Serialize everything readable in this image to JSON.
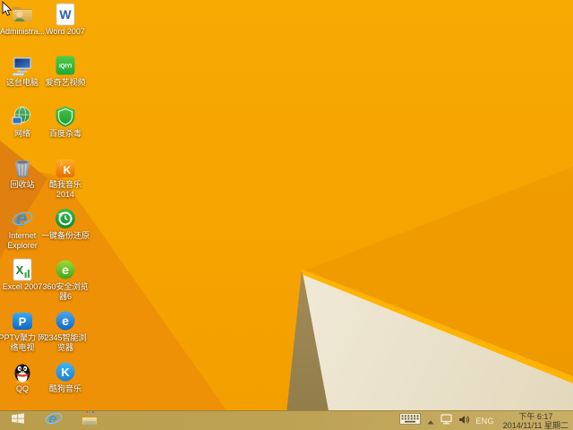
{
  "desktop": {
    "cursor": "arrow-cursor",
    "icons": [
      {
        "id": "administrator",
        "type": "admin-folder",
        "icon": "administrator-folder-icon",
        "label_lines": [
          "Administra..."
        ],
        "col": 0,
        "row": 0
      },
      {
        "id": "word-2007",
        "type": "word",
        "icon": "word-2007-icon",
        "glyph": "W",
        "label_lines": [
          "Word 2007"
        ],
        "col": 1,
        "row": 0
      },
      {
        "id": "this-pc",
        "type": "this-pc",
        "icon": "this-pc-icon",
        "label_lines": [
          "这台电脑"
        ],
        "col": 0,
        "row": 1
      },
      {
        "id": "iqiyi-video",
        "type": "iqiyi",
        "icon": "iqiyi-icon",
        "glyph": "iQIYI",
        "label_lines": [
          "爱奇艺视频"
        ],
        "col": 1,
        "row": 1
      },
      {
        "id": "network",
        "type": "network",
        "icon": "network-globe-icon",
        "label_lines": [
          "网络"
        ],
        "col": 0,
        "row": 2
      },
      {
        "id": "baidu-antivirus",
        "type": "baidu-av",
        "icon": "baidu-antivirus-shield-icon",
        "label_lines": [
          "百度杀毒"
        ],
        "col": 1,
        "row": 2
      },
      {
        "id": "recycle-bin",
        "type": "recycle-bin",
        "icon": "recycle-bin-icon",
        "label_lines": [
          "回收站"
        ],
        "col": 0,
        "row": 3
      },
      {
        "id": "kuwo-music-2014",
        "type": "kuwo",
        "icon": "kuwo-music-icon",
        "glyph": "K",
        "label_lines": [
          "酷我音乐",
          "2014"
        ],
        "col": 1,
        "row": 3
      },
      {
        "id": "internet-explorer",
        "type": "ie",
        "icon": "internet-explorer-icon",
        "glyph": "e",
        "label_lines": [
          "Internet",
          "Explorer"
        ],
        "col": 0,
        "row": 4
      },
      {
        "id": "onekey-backup-restore",
        "type": "backup",
        "icon": "onekey-backup-restore-icon",
        "label_lines": [
          "一键备份还原"
        ],
        "col": 1,
        "row": 4
      },
      {
        "id": "excel-2007",
        "type": "excel",
        "icon": "excel-2007-icon",
        "glyph": "X",
        "label_lines": [
          "Excel 2007"
        ],
        "col": 0,
        "row": 5
      },
      {
        "id": "360-safe-browser-6",
        "type": "b360se",
        "icon": "360-browser-icon",
        "glyph": "e",
        "label_lines": [
          "360安全浏览",
          "器6"
        ],
        "col": 1,
        "row": 5
      },
      {
        "id": "pptv",
        "type": "pptv",
        "icon": "pptv-icon",
        "glyph": "P",
        "label_lines": [
          "PPTV聚力 网",
          "络电视"
        ],
        "col": 0,
        "row": 6
      },
      {
        "id": "2345-smart-browser",
        "type": "b2345",
        "icon": "2345-browser-icon",
        "glyph": "e",
        "label_lines": [
          "2345智能浏",
          "览器"
        ],
        "col": 1,
        "row": 6
      },
      {
        "id": "qq",
        "type": "qq",
        "icon": "qq-penguin-icon",
        "label_lines": [
          "QQ"
        ],
        "col": 0,
        "row": 7
      },
      {
        "id": "kugou-music",
        "type": "kugou",
        "icon": "kugou-music-icon",
        "glyph": "K",
        "label_lines": [
          "酷狗音乐"
        ],
        "col": 1,
        "row": 7
      }
    ]
  },
  "taskbar": {
    "pinned_icons": [
      "start-icon",
      "ie-icon",
      "file-explorer-icon"
    ],
    "tray": {
      "icons": [
        "touch-keyboard-icon",
        "show-hidden-icons-chevron",
        "network-status-icon",
        "volume-icon"
      ],
      "language": "ENG",
      "time": "下午 6:17",
      "date": "2014/11/11 星期二"
    }
  },
  "colors": {
    "wallpaper_orange": "#F7A600",
    "wallpaper_dark_facet": "#E0800F",
    "wallpaper_stripe": "#FFB304",
    "wallpaper_cream": "#F2ECDC",
    "wallpaper_khaki": "#AD9360",
    "taskbar": "#BEA355"
  }
}
